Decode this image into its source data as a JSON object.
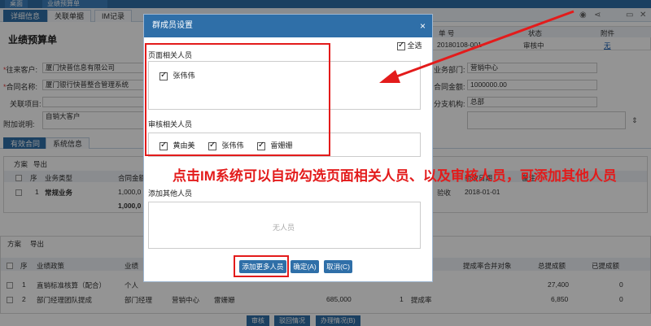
{
  "topbar": {
    "home_label": "桌面",
    "tab_label": "业绩预算单"
  },
  "tabs": [
    "详细信息",
    "关联单据",
    "IM记录"
  ],
  "page_title": "业绩预算单",
  "form": {
    "customer_label": "往来客户:",
    "customer_value": "厦门快普信息有限公司",
    "contract_label": "合同名称:",
    "contract_value": "厦门银行快普整合管理系统",
    "project_label": "关联项目:",
    "remark_label": "附加说明:",
    "remark_value": "自销大客户",
    "dept_label": "业务部门:",
    "dept_value": "营销中心",
    "amount_label": "合同金额:",
    "amount_value": "1000000.00",
    "branch_label": "分支机构:",
    "branch_value": "总部"
  },
  "header_table": {
    "cols": [
      "单  号",
      "状态",
      "附件"
    ],
    "row": [
      "20180108-001",
      "审核中",
      "无"
    ]
  },
  "sub_tabs": [
    "有效合同",
    "系统信息"
  ],
  "grid1": {
    "toolbar": [
      "方案",
      "导出"
    ],
    "headers": [
      "序",
      "业务类型",
      "合同金额"
    ],
    "rows": [
      [
        "1",
        "常规业务",
        "1,000,0"
      ]
    ],
    "total": "1,000,0",
    "right_headers": [
      "备注"
    ],
    "right_cells": [
      "验收",
      "2018-01-01"
    ],
    "right_header_label": "验收日期"
  },
  "grid2": {
    "toolbar": [
      "方案",
      "导出"
    ],
    "headers": [
      "序",
      "业绩政策",
      "业绩",
      "提成率合并对象",
      "总提成额",
      "已提成额"
    ],
    "rows": [
      [
        "1",
        "直销标准核算（配合）",
        "个人",
        "",
        "27,400",
        "0"
      ],
      [
        "2",
        "部门经理团队提成",
        "部门经理",
        "营销中心",
        "雷姗姗",
        "685,000",
        "1",
        "提成率",
        "6,850",
        "0"
      ]
    ]
  },
  "bottom_buttons": [
    "审核",
    "驳回情况",
    "办理情况(B)"
  ],
  "modal": {
    "title": "群成员设置",
    "select_all": "全选",
    "page_section": "页面相关人员",
    "page_people": [
      "张伟伟"
    ],
    "review_section": "审核相关人员",
    "review_people": [
      "黄由美",
      "张伟伟",
      "雷姗姗"
    ],
    "other_section": "添加其他人员",
    "no_person": "无人员",
    "btn_add": "添加更多人员",
    "btn_ok": "确定(A)",
    "btn_cancel": "取消(C)"
  },
  "annotation": "点击IM系统可以自动勾选页面相关人员、以及审核人员，可添加其他人员",
  "colors": {
    "primary": "#2f6fa8",
    "annotation": "#e31b1b"
  }
}
